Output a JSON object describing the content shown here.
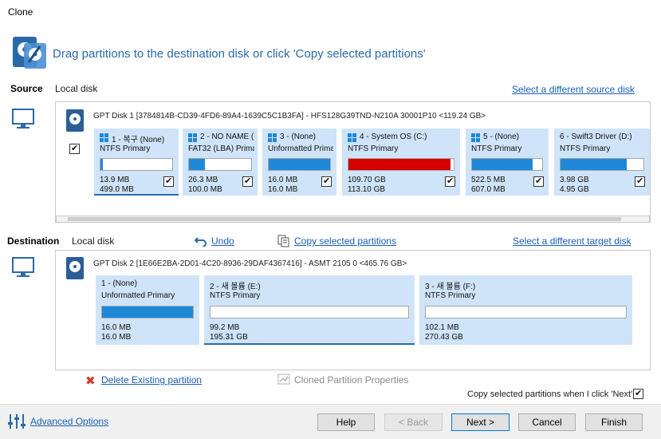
{
  "window": {
    "title": "Clone"
  },
  "header": {
    "text": "Drag partitions to the destination disk or click 'Copy selected partitions'"
  },
  "source": {
    "label": "Source",
    "sublabel": "Local disk",
    "link": "Select a different source disk",
    "disk_title": "GPT Disk 1 [3784814B-CD39-4FD6-89A4-1639C5C1B3FA] - HFS128G39TND-N210A 30001P10  <119.24 GB>",
    "partitions": [
      {
        "name": "1 - 복구 (None)",
        "fs": "NTFS Primary",
        "used": "13.9 MB",
        "total": "499.0 MB",
        "fill": 0.03,
        "color": "#1f88d8"
      },
      {
        "name": "2 - NO NAME (",
        "fs": "FAT32 (LBA) Primar",
        "used": "26.3 MB",
        "total": "100.0 MB",
        "fill": 0.26,
        "color": "#1f88d8"
      },
      {
        "name": "3 -  (None)",
        "fs": "Unformatted Primary",
        "used": "16.0 MB",
        "total": "16.0 MB",
        "fill": 1.0,
        "color": "#1f88d8"
      },
      {
        "name": "4 - System OS (C:)",
        "fs": "NTFS Primary",
        "used": "109.70 GB",
        "total": "113.10 GB",
        "fill": 0.97,
        "color": "#d40000"
      },
      {
        "name": "5 -  (None)",
        "fs": "NTFS Primary",
        "used": "522.5 MB",
        "total": "607.0 MB",
        "fill": 0.86,
        "color": "#1f88d8"
      },
      {
        "name": "6 - Swift3 Driver (D:)",
        "fs": "NTFS Primary",
        "used": "3.98 GB",
        "total": "4.95 GB",
        "fill": 0.8,
        "color": "#1f88d8"
      }
    ]
  },
  "destination": {
    "label": "Destination",
    "sublabel": "Local disk",
    "undo": "Undo",
    "copy_selected": "Copy selected partitions",
    "link": "Select a different target disk",
    "disk_title": "GPT Disk 2 [1E66E2BA-2D01-4C20-8936-29DAF4367416] - ASMT      2105              0  <465.76 GB>",
    "partitions": [
      {
        "name": "1 -  (None)",
        "fs": "Unformatted Primary",
        "used": "16.0 MB",
        "total": "16.0 MB",
        "fill": 1.0,
        "color": "#1f88d8"
      },
      {
        "name": "2 - 새 볼륨 (E:)",
        "fs": "NTFS Primary",
        "used": "99.2 MB",
        "total": "195.31 GB",
        "fill": 0.0,
        "color": "#1f88d8"
      },
      {
        "name": "3 - 새 볼륨 (F:)",
        "fs": "NTFS Primary",
        "used": "102.1 MB",
        "total": "270.43 GB",
        "fill": 0.0,
        "color": "#1f88d8"
      }
    ],
    "delete_link": "Delete Existing partition",
    "cloned_props": "Cloned Partition Properties",
    "copy_when_next": "Copy selected partitions when I click 'Next'"
  },
  "footer": {
    "advanced": "Advanced Options",
    "help": "Help",
    "back": "< Back",
    "next": "Next >",
    "cancel": "Cancel",
    "finish": "Finish"
  },
  "colors": {
    "accent": "#1f88d8",
    "partition_bg": "#cfe4f8",
    "used_red": "#d40000",
    "link": "#1a5fb4"
  }
}
